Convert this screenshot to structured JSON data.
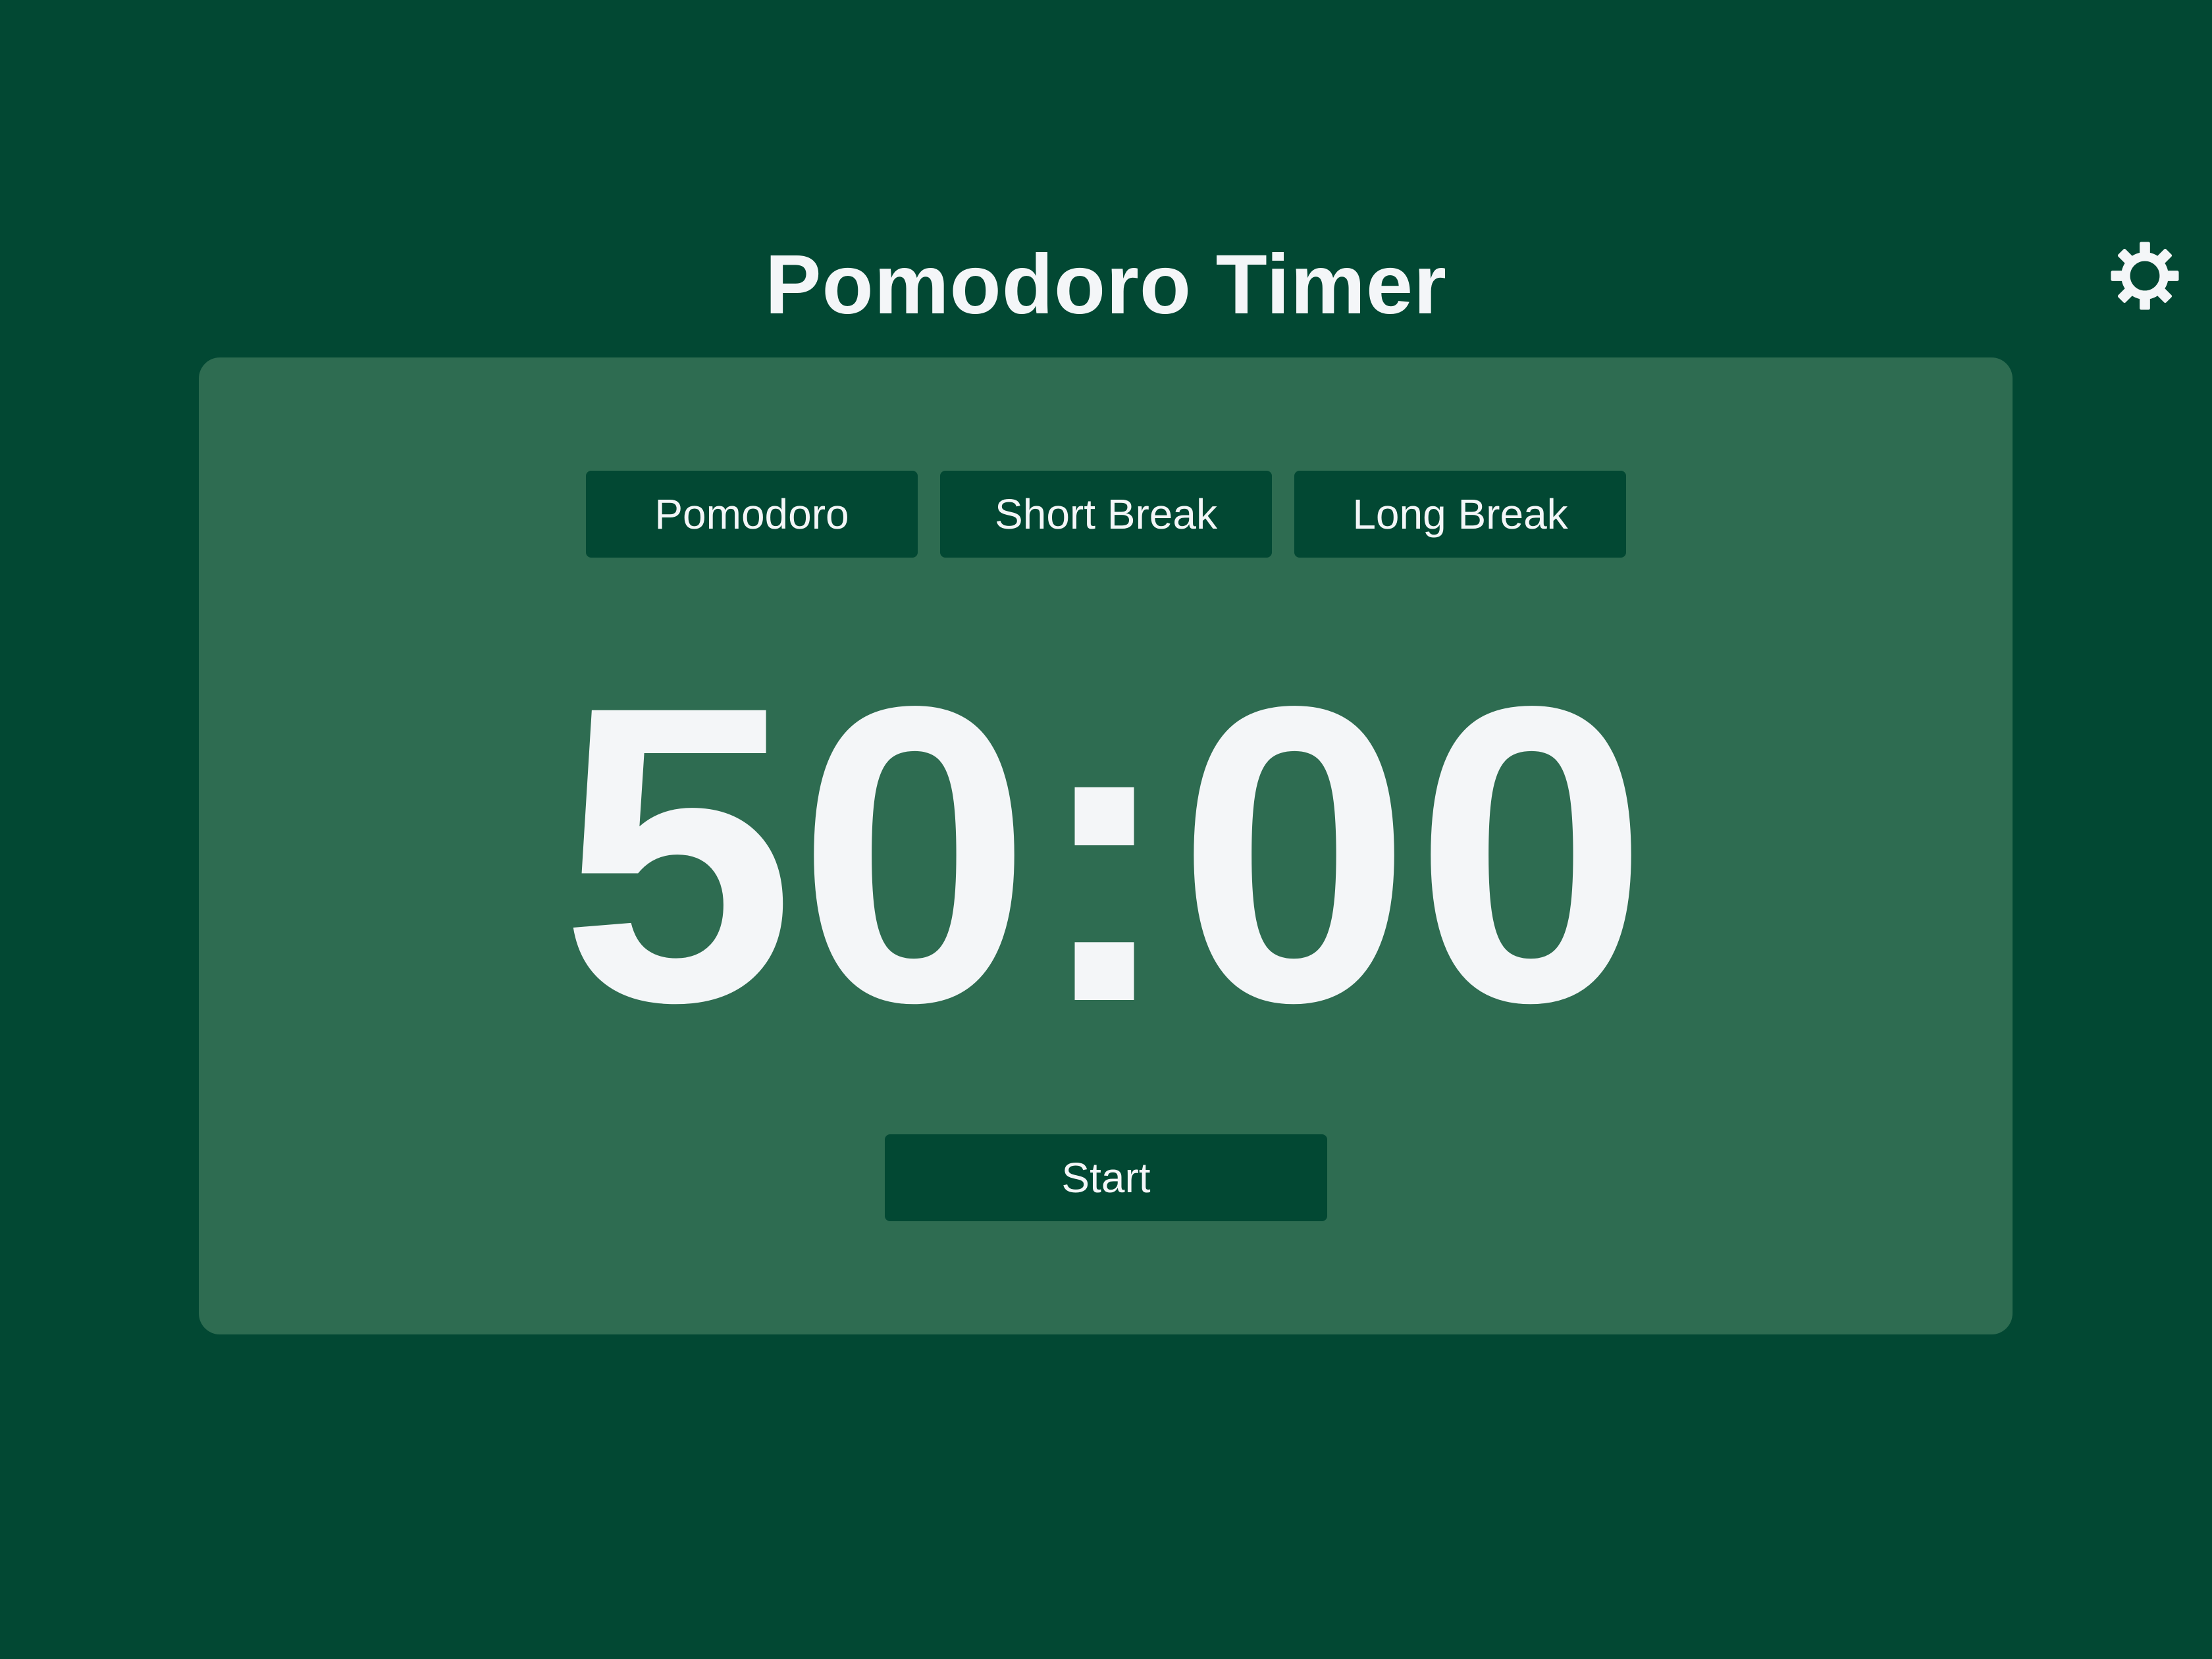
{
  "header": {
    "title": "Pomodoro Timer",
    "settings_icon": "gear-icon"
  },
  "tabs": [
    {
      "label": "Pomodoro"
    },
    {
      "label": "Short Break"
    },
    {
      "label": "Long Break"
    }
  ],
  "timer": {
    "display": "50:00"
  },
  "controls": {
    "start_label": "Start"
  },
  "colors": {
    "background": "#024833",
    "card": "#2e6c51",
    "button": "#024833",
    "text": "#f4f6f8"
  }
}
